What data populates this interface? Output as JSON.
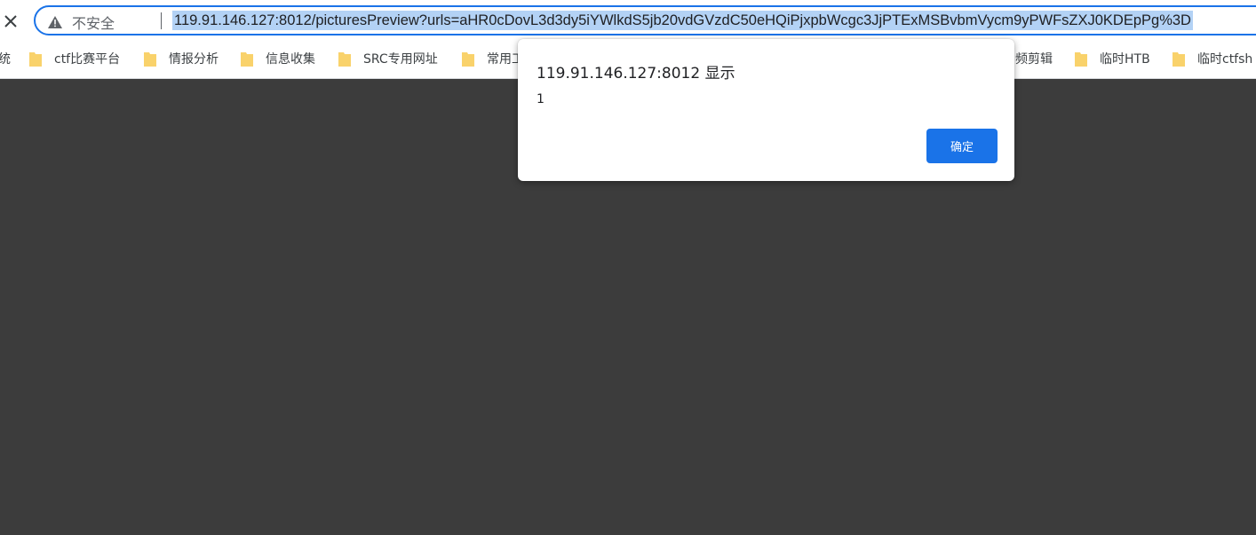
{
  "browser": {
    "security_label": "不安全",
    "url": "119.91.146.127:8012/picturesPreview?urls=aHR0cDovL3d3dy5iYWlkdS5jb20vdGVzdC50eHQiPjxpbWcgc3JjPTExMSBvbmVycm9yPWFsZXJ0KDEpPg%3D"
  },
  "bookmarks": [
    {
      "label": "统"
    },
    {
      "label": "ctf比赛平台"
    },
    {
      "label": "情报分析"
    },
    {
      "label": "信息收集"
    },
    {
      "label": "SRC专用网址"
    },
    {
      "label": "常用工"
    },
    {
      "label": "频剪辑"
    },
    {
      "label": "临时HTB"
    },
    {
      "label": "临时ctfsh"
    }
  ],
  "dialog": {
    "title": "119.91.146.127:8012 显示",
    "message": "1",
    "ok_label": "确定"
  },
  "colors": {
    "accent": "#1a73e8",
    "page_background": "#3c3c3c",
    "url_highlight": "#b3d2f5",
    "folder": "#f9d26b"
  }
}
